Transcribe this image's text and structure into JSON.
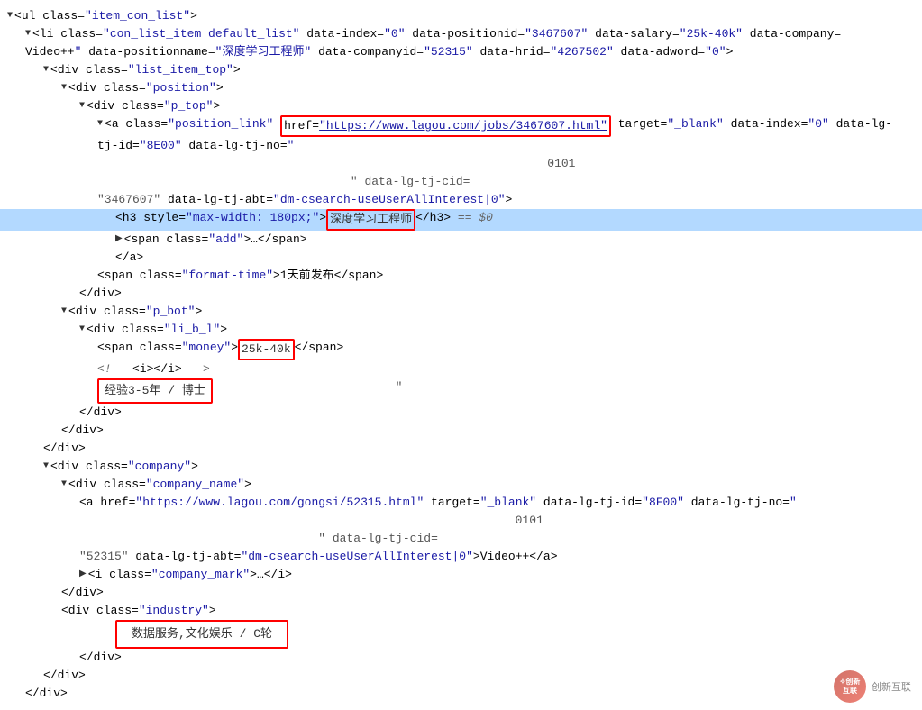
{
  "lines": [
    {
      "id": "l1",
      "indent": 0,
      "highlight": false,
      "collapsed": false,
      "content": [
        {
          "type": "triangle",
          "dir": "down"
        },
        {
          "type": "tag-open",
          "text": "<ul class="
        },
        {
          "type": "attr-val",
          "text": "\"item_con_list\""
        },
        {
          "type": "tag-close",
          "text": ">"
        }
      ]
    },
    {
      "id": "l2",
      "indent": 1,
      "highlight": false,
      "collapsed": false,
      "content": [
        {
          "type": "triangle",
          "dir": "down"
        },
        {
          "type": "tag-open",
          "text": "<li class="
        },
        {
          "type": "attr-val",
          "text": "\"con_list_item default_list\""
        },
        {
          "type": "text",
          "text": " data-index="
        },
        {
          "type": "attr-val",
          "text": "\"0\""
        },
        {
          "type": "text",
          "text": " data-positionid="
        },
        {
          "type": "attr-val",
          "text": "\"3467607\""
        },
        {
          "type": "text",
          "text": " data-salary="
        },
        {
          "type": "attr-val",
          "text": "\"25k-40k\""
        },
        {
          "type": "text",
          "text": " data-company="
        }
      ]
    },
    {
      "id": "l2b",
      "indent": 1,
      "highlight": false,
      "collapsed": false,
      "content": [
        {
          "type": "text",
          "text": "Video++"
        },
        {
          "type": "attr-val",
          "text": "\""
        },
        {
          "type": "text",
          "text": " data-positionname="
        },
        {
          "type": "attr-val",
          "text": "\"深度学习工程师\""
        },
        {
          "type": "text",
          "text": " data-companyid="
        },
        {
          "type": "attr-val",
          "text": "\"52315\""
        },
        {
          "type": "text",
          "text": " data-hrid="
        },
        {
          "type": "attr-val",
          "text": "\"4267502\""
        },
        {
          "type": "text",
          "text": " data-adword="
        },
        {
          "type": "attr-val",
          "text": "\"0\""
        },
        {
          "type": "tag-close",
          "text": ">"
        }
      ]
    },
    {
      "id": "l3",
      "indent": 2,
      "highlight": false,
      "collapsed": false,
      "content": [
        {
          "type": "triangle",
          "dir": "down"
        },
        {
          "type": "tag-open",
          "text": "<div class="
        },
        {
          "type": "attr-val",
          "text": "\"list_item_top\""
        },
        {
          "type": "tag-close",
          "text": ">"
        }
      ]
    },
    {
      "id": "l4",
      "indent": 3,
      "highlight": false,
      "collapsed": false,
      "content": [
        {
          "type": "triangle",
          "dir": "down"
        },
        {
          "type": "tag-open",
          "text": "<div class="
        },
        {
          "type": "attr-val",
          "text": "\"position\""
        },
        {
          "type": "tag-close",
          "text": ">"
        }
      ]
    },
    {
      "id": "l5",
      "indent": 4,
      "highlight": false,
      "collapsed": false,
      "content": [
        {
          "type": "triangle",
          "dir": "down"
        },
        {
          "type": "tag-open",
          "text": "<div class="
        },
        {
          "type": "attr-val",
          "text": "\"p_top\""
        },
        {
          "type": "tag-close",
          "text": ">"
        }
      ]
    },
    {
      "id": "l6",
      "indent": 5,
      "highlight": false,
      "collapsed": false,
      "content": [
        {
          "type": "triangle",
          "dir": "down"
        },
        {
          "type": "tag-open",
          "text": "<a class="
        },
        {
          "type": "attr-val",
          "text": "\"position_link\""
        },
        {
          "type": "text",
          "text": " "
        },
        {
          "type": "red-box-start",
          "text": "href="
        },
        {
          "type": "attr-val-red",
          "text": "\"https://www.lagou.com/jobs/3467607.html\""
        },
        {
          "type": "red-box-end",
          "text": ""
        },
        {
          "type": "text",
          "text": " target="
        },
        {
          "type": "attr-val",
          "text": "\"_blank\""
        },
        {
          "type": "text",
          "text": " data-index="
        },
        {
          "type": "attr-val",
          "text": "\"0\""
        },
        {
          "type": "text",
          "text": " data-lg-"
        }
      ]
    },
    {
      "id": "l6b",
      "indent": 5,
      "highlight": false,
      "content": [
        {
          "type": "text",
          "text": "tj-id="
        },
        {
          "type": "attr-val",
          "text": "\"8E00\""
        },
        {
          "type": "text",
          "text": " data-lg-tj-no="
        },
        {
          "type": "attr-val",
          "text": "\""
        }
      ]
    },
    {
      "id": "l6c",
      "indent": 5,
      "highlight": false,
      "content": [
        {
          "type": "grey",
          "text": "                                                                0101"
        }
      ]
    },
    {
      "id": "l6d",
      "indent": 5,
      "highlight": false,
      "content": [
        {
          "type": "grey",
          "text": "                                    \" data-lg-tj-cid="
        }
      ]
    },
    {
      "id": "l7",
      "indent": 5,
      "highlight": false,
      "content": [
        {
          "type": "grey",
          "text": "\"3467607\""
        },
        {
          "type": "text",
          "text": " data-lg-tj-abt="
        },
        {
          "type": "attr-val",
          "text": "\"dm-csearch-useUserAllInterest|0\""
        },
        {
          "type": "tag-close",
          "text": ">"
        }
      ]
    },
    {
      "id": "l8",
      "indent": 6,
      "highlight": true,
      "content": [
        {
          "type": "tag-open",
          "text": "<h3 style="
        },
        {
          "type": "attr-val",
          "text": "\"max-width: 180px;\""
        },
        {
          "type": "tag-close",
          "text": ">"
        },
        {
          "type": "red-box-text",
          "text": "深度学习工程师"
        },
        {
          "type": "end-tag",
          "text": "</h3>"
        },
        {
          "type": "comment",
          "text": " == $0"
        }
      ]
    },
    {
      "id": "l9",
      "indent": 6,
      "highlight": false,
      "content": [
        {
          "type": "triangle",
          "dir": "right"
        },
        {
          "type": "tag-open",
          "text": "<span class="
        },
        {
          "type": "attr-val",
          "text": "\"add\""
        },
        {
          "type": "tag-close",
          "text": ">…</span>"
        }
      ]
    },
    {
      "id": "l10",
      "indent": 6,
      "highlight": false,
      "content": [
        {
          "type": "end-tag",
          "text": "</a>"
        }
      ]
    },
    {
      "id": "l11",
      "indent": 5,
      "highlight": false,
      "content": [
        {
          "type": "tag-open",
          "text": "<span class="
        },
        {
          "type": "attr-val",
          "text": "\"format-time\""
        },
        {
          "type": "tag-close",
          "text": ">1天前发布</span>"
        }
      ]
    },
    {
      "id": "l12",
      "indent": 4,
      "highlight": false,
      "content": [
        {
          "type": "end-tag",
          "text": "</div>"
        }
      ]
    },
    {
      "id": "l13",
      "indent": 3,
      "highlight": false,
      "content": [
        {
          "type": "triangle",
          "dir": "down"
        },
        {
          "type": "tag-open",
          "text": "<div class="
        },
        {
          "type": "attr-val",
          "text": "\"p_bot\""
        },
        {
          "type": "tag-close",
          "text": ">"
        }
      ]
    },
    {
      "id": "l14",
      "indent": 4,
      "highlight": false,
      "content": [
        {
          "type": "triangle",
          "dir": "down"
        },
        {
          "type": "tag-open",
          "text": "<div class="
        },
        {
          "type": "attr-val",
          "text": "\"li_b_l\""
        },
        {
          "type": "tag-close",
          "text": ">"
        }
      ]
    },
    {
      "id": "l15",
      "indent": 5,
      "highlight": false,
      "content": [
        {
          "type": "tag-open",
          "text": "<span class="
        },
        {
          "type": "attr-val",
          "text": "\"money\""
        },
        {
          "type": "tag-close",
          "text": ">"
        },
        {
          "type": "red-box-text",
          "text": "25k-40k"
        },
        {
          "type": "end-tag",
          "text": "</span>"
        }
      ]
    },
    {
      "id": "l16",
      "indent": 5,
      "highlight": false,
      "content": [
        {
          "type": "comment",
          "text": "<!-- "
        },
        {
          "type": "tag-open",
          "text": "<i>"
        },
        {
          "type": "end-tag",
          "text": "</i>"
        },
        {
          "type": "comment",
          "text": " -->"
        }
      ]
    },
    {
      "id": "l17",
      "indent": 5,
      "highlight": false,
      "content": [
        {
          "type": "red-box-text",
          "text": "经验3-5年 / 博士"
        },
        {
          "type": "grey",
          "text": "                            \""
        }
      ]
    },
    {
      "id": "l18",
      "indent": 4,
      "highlight": false,
      "content": [
        {
          "type": "end-tag",
          "text": "</div>"
        }
      ]
    },
    {
      "id": "l19",
      "indent": 3,
      "highlight": false,
      "content": [
        {
          "type": "end-tag",
          "text": "</div>"
        }
      ]
    },
    {
      "id": "l20",
      "indent": 2,
      "highlight": false,
      "content": [
        {
          "type": "end-tag",
          "text": "</div>"
        }
      ]
    },
    {
      "id": "l21",
      "indent": 2,
      "highlight": false,
      "content": [
        {
          "type": "triangle",
          "dir": "down"
        },
        {
          "type": "tag-open",
          "text": "<div class="
        },
        {
          "type": "attr-val",
          "text": "\"company\""
        },
        {
          "type": "tag-close",
          "text": ">"
        }
      ]
    },
    {
      "id": "l22",
      "indent": 3,
      "highlight": false,
      "content": [
        {
          "type": "triangle",
          "dir": "down"
        },
        {
          "type": "tag-open",
          "text": "<div class="
        },
        {
          "type": "attr-val",
          "text": "\"company_name\""
        },
        {
          "type": "tag-close",
          "text": ">"
        }
      ]
    },
    {
      "id": "l23",
      "indent": 4,
      "highlight": false,
      "content": [
        {
          "type": "tag-open",
          "text": "<a href="
        },
        {
          "type": "attr-val",
          "text": "\"https://www.lagou.com/gongsi/52315.html\""
        },
        {
          "type": "text",
          "text": " target="
        },
        {
          "type": "attr-val",
          "text": "\"_blank\""
        },
        {
          "type": "text",
          "text": " data-lg-tj-id="
        },
        {
          "type": "attr-val",
          "text": "\"8F00\""
        },
        {
          "type": "text",
          "text": " data-lg-tj-no="
        },
        {
          "type": "attr-val",
          "text": "\""
        }
      ]
    },
    {
      "id": "l23b",
      "indent": 4,
      "highlight": false,
      "content": [
        {
          "type": "grey",
          "text": "                                                              0101"
        }
      ]
    },
    {
      "id": "l23c",
      "indent": 4,
      "highlight": false,
      "content": [
        {
          "type": "grey",
          "text": "                                  \" data-lg-tj-cid="
        }
      ]
    },
    {
      "id": "l24",
      "indent": 4,
      "highlight": false,
      "content": [
        {
          "type": "grey",
          "text": "\"52315\""
        },
        {
          "type": "text",
          "text": " data-lg-tj-abt="
        },
        {
          "type": "attr-val",
          "text": "\"dm-csearch-useUserAllInterest|0\""
        },
        {
          "type": "tag-close",
          "text": ">Video++</a>"
        }
      ]
    },
    {
      "id": "l25",
      "indent": 4,
      "highlight": false,
      "content": [
        {
          "type": "triangle",
          "dir": "right"
        },
        {
          "type": "tag-open",
          "text": "<i class="
        },
        {
          "type": "attr-val",
          "text": "\"company_mark\""
        },
        {
          "type": "tag-close",
          "text": ">…</i>"
        }
      ]
    },
    {
      "id": "l26",
      "indent": 3,
      "highlight": false,
      "content": [
        {
          "type": "end-tag",
          "text": "</div>"
        }
      ]
    },
    {
      "id": "l27",
      "indent": 3,
      "highlight": false,
      "content": [
        {
          "type": "tag-open",
          "text": "<div class="
        },
        {
          "type": "attr-val",
          "text": "\"industry\""
        },
        {
          "type": "tag-close",
          "text": ">"
        }
      ]
    },
    {
      "id": "l27b",
      "indent": 4,
      "highlight": false,
      "content": [
        {
          "type": "red-box-text-wide",
          "text": "数据服务,文化娱乐 / C轮"
        }
      ]
    },
    {
      "id": "l27c",
      "indent": 4,
      "highlight": false,
      "content": [
        {
          "type": "end-tag",
          "text": "</div>"
        }
      ]
    },
    {
      "id": "l28",
      "indent": 2,
      "highlight": false,
      "content": [
        {
          "type": "end-tag",
          "text": "</div>"
        }
      ]
    },
    {
      "id": "l29",
      "indent": 1,
      "highlight": false,
      "content": [
        {
          "type": "end-tag",
          "text": "</div>"
        }
      ]
    }
  ],
  "watermark": {
    "logo_text": "创新\n互联",
    "text": "创新互联"
  }
}
